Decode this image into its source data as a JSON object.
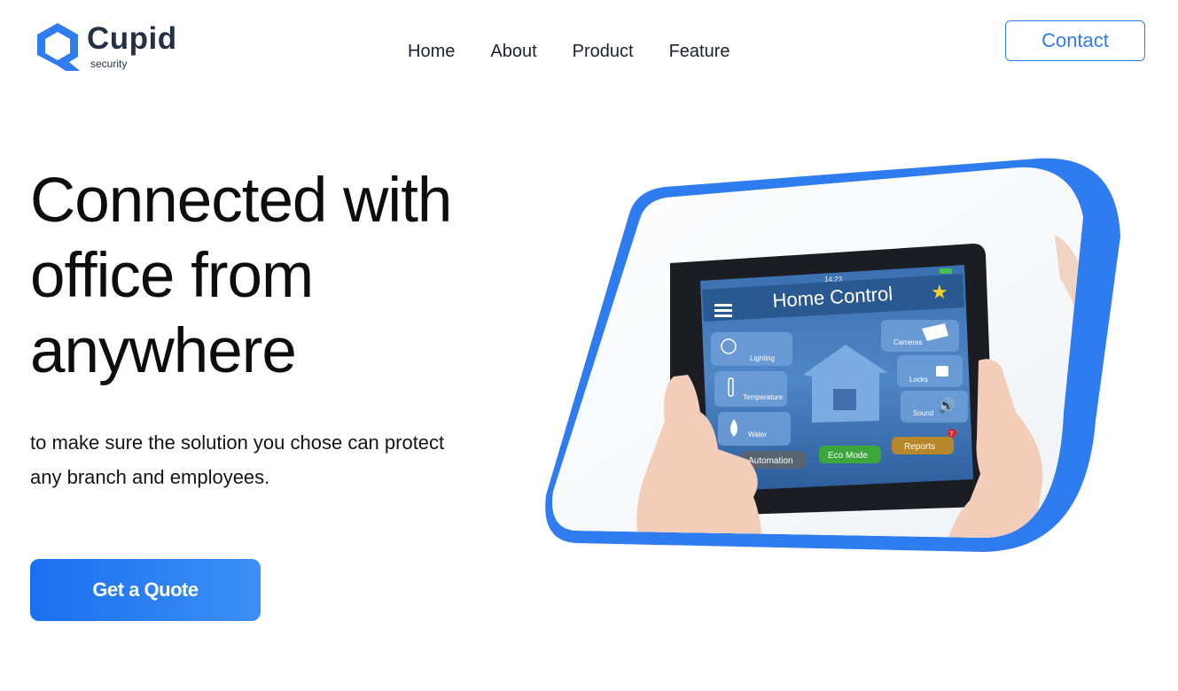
{
  "header": {
    "brand": "Cupid",
    "tagline": "security",
    "nav": [
      "Home",
      "About",
      "Product",
      "Feature"
    ],
    "contact_label": "Contact"
  },
  "hero": {
    "title_lines": [
      "Connected with",
      "office from",
      "anywhere"
    ],
    "subtitle_lines": [
      "to make sure the solution you chose can protect",
      "any branch and employees."
    ],
    "cta_label": "Get a Quote"
  },
  "device_screen": {
    "time": "14:23",
    "title": "Home Control",
    "left_tiles": [
      "Lighting",
      "Temperature",
      "Water"
    ],
    "right_tiles": [
      "Cameras",
      "Locks",
      "Sound"
    ],
    "buttons": [
      "Automation",
      "Eco Mode",
      "Reports"
    ],
    "reports_badge": "7"
  },
  "colors": {
    "accent": "#2f7cf0",
    "brand_text": "#243044",
    "cta_start": "#1a6ff0",
    "cta_end": "#3d8ff5"
  }
}
